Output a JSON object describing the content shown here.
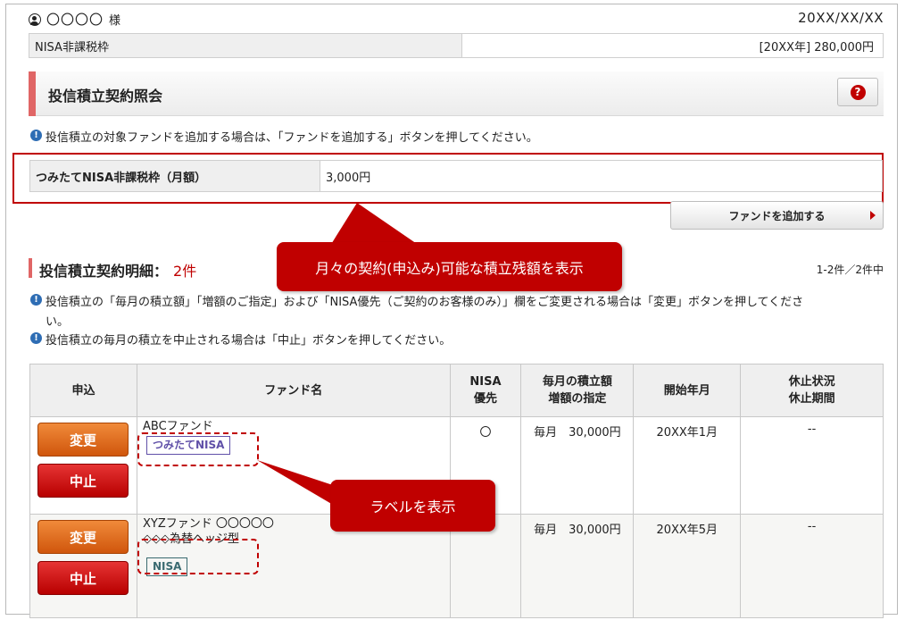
{
  "header": {
    "user_name": "〇〇〇〇",
    "user_suffix": "様",
    "date": "20XX/XX/XX",
    "nisa_label": "NISA非課税枠",
    "nisa_value": "[20XX年] 280,000円"
  },
  "page": {
    "title": "投信積立契約照会",
    "help_icon": "?",
    "info_icon": "!",
    "note_add": "投信積立の対象ファンドを追加する場合は、「ファンドを追加する」ボタンを押してください。"
  },
  "monthly": {
    "label": "つみたてNISA非課税枠（月額）",
    "value": "3,000円"
  },
  "add_button": "ファンドを追加する",
  "callouts": {
    "top": "月々の契約(申込み)可能な積立残額を表示",
    "label": "ラベルを表示"
  },
  "section": {
    "title": "投信積立契約明細：",
    "count": "2件",
    "paging": "1-2件／2件中",
    "note1_line1": "投信積立の「毎月の積立額」「増額のご指定」および「NISA優先（ご契約のお客様のみ）」欄をご変更される場合は「変更」ボタンを押してくださ",
    "note1_line2": "い。",
    "note2": "投信積立の毎月の積立を中止される場合は「中止」ボタンを押してください。"
  },
  "table": {
    "headers": {
      "apply": "申込",
      "fund": "ファンド名",
      "nisa_line1": "NISA",
      "nisa_line2": "優先",
      "amount_line1": "毎月の積立額",
      "amount_line2": "増額の指定",
      "start": "開始年月",
      "status_line1": "休止状況",
      "status_line2": "休止期間"
    },
    "rows": [
      {
        "change": "変更",
        "stop": "中止",
        "fund_line1": "ABCファンド",
        "fund_line2": "",
        "tag": "つみたてNISA",
        "nisa": "〇",
        "amount": "毎月　30,000円",
        "start": "20XX年1月",
        "status": "--"
      },
      {
        "change": "変更",
        "stop": "中止",
        "fund_line1": "XYZファンド 〇〇〇〇〇",
        "fund_line2": "◇◇◇為替ヘッジ型",
        "tag": "NISA",
        "nisa": "",
        "amount": "毎月　30,000円",
        "start": "20XX年5月",
        "status": "--"
      }
    ]
  },
  "colors": {
    "accent_red": "#c00000",
    "section_accent": "#e06666",
    "change_orange": "#d0560c",
    "info_blue": "#2e6db4"
  }
}
